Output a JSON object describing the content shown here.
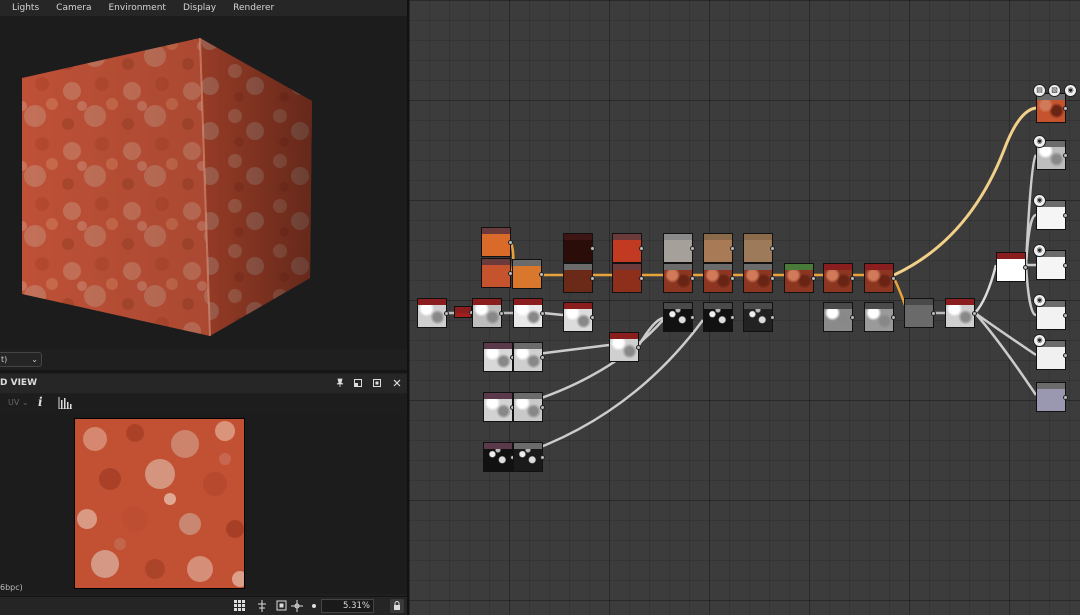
{
  "menu": [
    "Lights",
    "Camera",
    "Environment",
    "Display",
    "Renderer"
  ],
  "viewport3d": {
    "dropdown_value": "t)"
  },
  "view2d": {
    "title": "D VIEW",
    "uv_selector": "UV ⌄",
    "info_icon": "i",
    "format_text": "6bpc)",
    "zoom": "5.31%"
  },
  "icons": {
    "pin": "pin-icon",
    "restore": "restore-icon",
    "maximize": "maximize-icon",
    "close": "close-icon",
    "histogram": "histogram-icon",
    "grid": "grid-icon",
    "fit": "fit-icon",
    "lock": "lock-icon"
  },
  "colors": {
    "accent_wire": "#e8a23a",
    "output_wire": "#f2d08a",
    "rust": "#c4532e",
    "node_header_red": "#8a1d1d"
  }
}
